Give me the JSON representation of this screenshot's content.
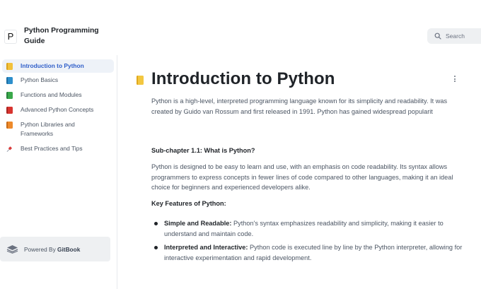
{
  "app": {
    "logo_letter": "P",
    "title": "Python Programming Guide"
  },
  "search": {
    "label": "Search",
    "icon": "search-icon"
  },
  "sidebar": {
    "items": [
      {
        "label": "Introduction to Python",
        "icon": "yellow-book-icon",
        "color": "#f2c13b",
        "active": true
      },
      {
        "label": "Python Basics",
        "icon": "blue-book-icon",
        "color": "#2d8fcc",
        "active": false
      },
      {
        "label": "Functions and Modules",
        "icon": "green-book-icon",
        "color": "#3aa84a",
        "active": false
      },
      {
        "label": "Advanced Python Concepts",
        "icon": "red-book-icon",
        "color": "#d8342f",
        "active": false
      },
      {
        "label": "Python Libraries and Frameworks",
        "icon": "orange-book-icon",
        "color": "#ee8a2b",
        "active": false
      },
      {
        "label": "Best Practices and Tips",
        "icon": "pushpin-icon",
        "color": "#d93b3b",
        "active": false
      }
    ],
    "powered_prefix": "Powered By",
    "powered_brand": "GitBook"
  },
  "page": {
    "icon": "yellow-book-icon",
    "title": "Introduction to Python",
    "intro": "Python is a high-level, interpreted programming language known for its simplicity and readability. It was created by Guido van Rossum and first released in 1991. Python has gained widespread popularit",
    "subchapter": "Sub-chapter 1.1: What is Python?",
    "paragraph": "Python is designed to be easy to learn and use, with an emphasis on code readability. Its syntax allows programmers to express concepts in fewer lines of code compared to other languages, making it an ideal choice for beginners and experienced developers alike.",
    "features_heading": "Key Features of Python:",
    "features": [
      {
        "term": "Simple and Readable:",
        "text": " Python's syntax emphasizes readability and simplicity, making it easier to understand and maintain code."
      },
      {
        "term": "Interpreted and Interactive:",
        "text": " Python code is executed line by line by the Python interpreter, allowing for interactive experimentation and rapid development."
      }
    ]
  },
  "colors": {
    "accent": "#2f5ec9",
    "active_bg": "#eef2f8"
  }
}
